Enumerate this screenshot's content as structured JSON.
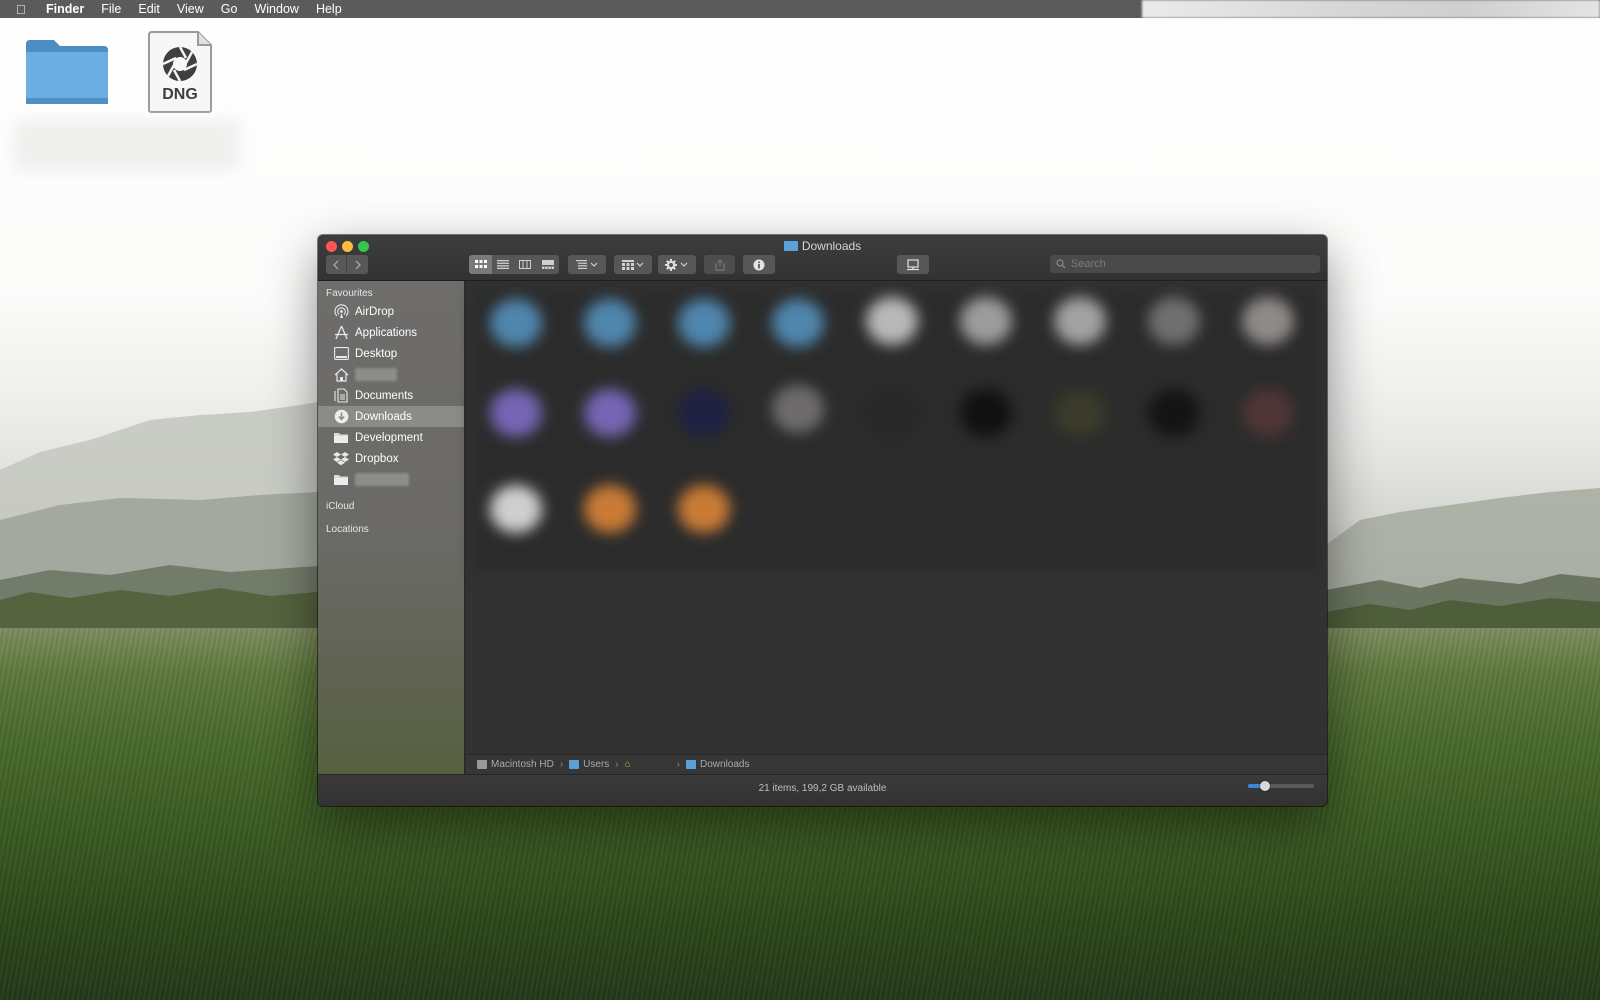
{
  "menubar": {
    "app_name": "Finder",
    "items": [
      "File",
      "Edit",
      "View",
      "Go",
      "Window",
      "Help"
    ]
  },
  "desktop": {
    "dng_label": "DNG"
  },
  "window": {
    "title": "Downloads",
    "search_placeholder": "Search",
    "sidebar": {
      "sections": {
        "favourites": "Favourites",
        "icloud": "iCloud",
        "locations": "Locations"
      },
      "items": [
        {
          "label": "AirDrop",
          "icon": "airdrop-icon"
        },
        {
          "label": "Applications",
          "icon": "applications-icon"
        },
        {
          "label": "Desktop",
          "icon": "desktop-icon"
        },
        {
          "label": "",
          "icon": "home-icon"
        },
        {
          "label": "Documents",
          "icon": "documents-icon"
        },
        {
          "label": "Downloads",
          "icon": "downloads-icon"
        },
        {
          "label": "Development",
          "icon": "folder-icon"
        },
        {
          "label": "Dropbox",
          "icon": "dropbox-icon"
        },
        {
          "label": "",
          "icon": "folder-icon"
        }
      ],
      "selected": "Downloads"
    },
    "pathbar": {
      "segments": [
        "Macintosh HD",
        "Users",
        "",
        "Downloads"
      ]
    },
    "status": "21 items, 199,2 GB available",
    "icon_size_slider": 0.25,
    "colors": {
      "accent": "#3f82e0",
      "folder_blue": "#5aa1da",
      "close": "#fc5753",
      "minimize": "#fdbc40",
      "maximize": "#34c84a"
    }
  }
}
